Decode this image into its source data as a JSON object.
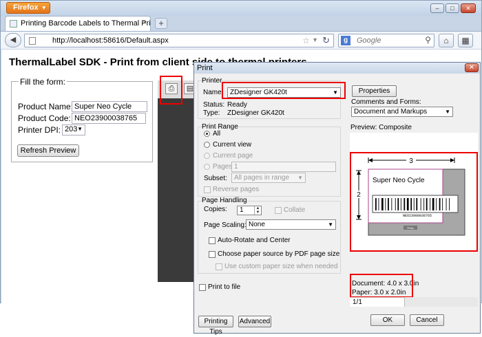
{
  "browser": {
    "menu_label": "Firefox",
    "tab_title": "Printing Barcode Labels to Thermal Print...",
    "new_tab": "+",
    "url": "http://localhost:58616/Default.aspx",
    "search_placeholder": "Google",
    "search_engine_letter": "g"
  },
  "page": {
    "title": "ThermalLabel SDK - Print from client side to thermal printers",
    "form_legend": "Fill the form:",
    "product_name_label": "Product Name:",
    "product_name_value": "Super Neo Cycle",
    "product_code_label": "Product Code:",
    "product_code_value": "NEO23900038765",
    "printer_dpi_label": "Printer DPI:",
    "printer_dpi_value": "203",
    "refresh_button": "Refresh Preview"
  },
  "print_dialog": {
    "title": "Print",
    "printer_group": "Printer",
    "name_label": "Name:",
    "printer_name": "ZDesigner GK420t",
    "properties_button": "Properties",
    "status_label": "Status:",
    "status_value": "Ready",
    "type_label": "Type:",
    "type_value": "ZDesigner GK420t",
    "comments_label": "Comments and Forms:",
    "comments_value": "Document and Markups",
    "print_range_group": "Print Range",
    "range_all": "All",
    "range_current_view": "Current view",
    "range_current_page": "Current page",
    "range_pages": "Pages",
    "pages_value": "1",
    "subset_label": "Subset:",
    "subset_value": "All pages in range",
    "reverse_pages": "Reverse pages",
    "page_handling_group": "Page Handling",
    "copies_label": "Copies:",
    "copies_value": "1",
    "collate": "Collate",
    "scaling_label": "Page Scaling:",
    "scaling_value": "None",
    "auto_rotate": "Auto-Rotate and Center",
    "choose_paper": "Choose paper source by PDF page size",
    "custom_paper": "Use custom paper size when needed",
    "print_to_file": "Print to file",
    "preview_label": "Preview: Composite",
    "doc_size": "Document: 4.0 x 3.0in",
    "paper_size": "Paper: 3.0 x 2.0in",
    "page_counter": "1/1",
    "tips_button": "Printing Tips",
    "advanced_button": "Advanced",
    "ok_button": "OK",
    "cancel_button": "Cancel"
  },
  "label_preview": {
    "width_dim": "3",
    "height_dim": "2",
    "product_name": "Super Neo Cycle",
    "barcode_text": "NEO23900038765",
    "watermark": "TRIAL"
  }
}
